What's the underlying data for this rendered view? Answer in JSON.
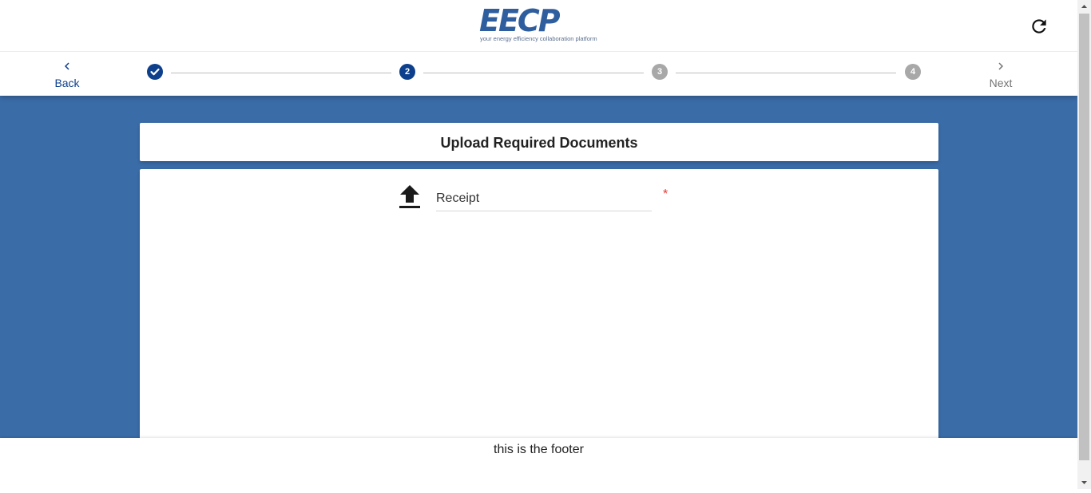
{
  "header": {
    "logo_text": "EECP",
    "logo_tagline": "your energy efficiency collaboration platform",
    "refresh_icon": "refresh-icon"
  },
  "stepper": {
    "back_label": "Back",
    "next_label": "Next",
    "steps": [
      {
        "label": "",
        "state": "done"
      },
      {
        "label": "2",
        "state": "active"
      },
      {
        "label": "3",
        "state": "pending"
      },
      {
        "label": "4",
        "state": "pending"
      }
    ]
  },
  "main": {
    "title": "Upload Required Documents",
    "upload": {
      "label": "Receipt",
      "required_mark": "*",
      "icon": "upload-icon"
    }
  },
  "footer": {
    "text": "this is the footer"
  },
  "colors": {
    "primary": "#0d3f8c",
    "background": "#3a6ca8",
    "logo": "#2f5e9e",
    "step_pending": "#a8a8a8",
    "required": "#e53935"
  }
}
